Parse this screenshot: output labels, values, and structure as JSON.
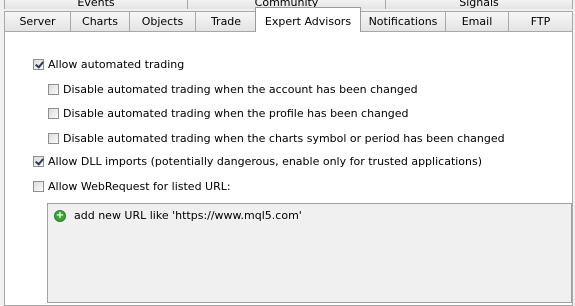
{
  "tabs_row1": [
    {
      "label": "Events"
    },
    {
      "label": "Community"
    },
    {
      "label": "Signals"
    }
  ],
  "tabs_row2": [
    {
      "label": "Server"
    },
    {
      "label": "Charts"
    },
    {
      "label": "Objects"
    },
    {
      "label": "Trade"
    },
    {
      "label": "Expert Advisors",
      "active": true
    },
    {
      "label": "Notifications"
    },
    {
      "label": "Email"
    },
    {
      "label": "FTP"
    }
  ],
  "options": {
    "allow_automated": {
      "label": "Allow automated trading",
      "checked": true
    },
    "disable_account": {
      "label": "Disable automated trading when the account has been changed",
      "checked": false
    },
    "disable_profile": {
      "label": "Disable automated trading when the profile has been changed",
      "checked": false
    },
    "disable_symbol": {
      "label": "Disable automated trading when the charts symbol or period has been changed",
      "checked": false
    },
    "allow_dll": {
      "label": "Allow DLL imports (potentially dangerous, enable only for trusted applications)",
      "checked": true
    },
    "allow_webrequest": {
      "label": "Allow WebRequest for listed URL:",
      "checked": false
    }
  },
  "url_list": {
    "add_label": "add new URL like 'https://www.mql5.com'",
    "icon": "plus-circle-icon",
    "icon_color": "#3aa33a"
  }
}
